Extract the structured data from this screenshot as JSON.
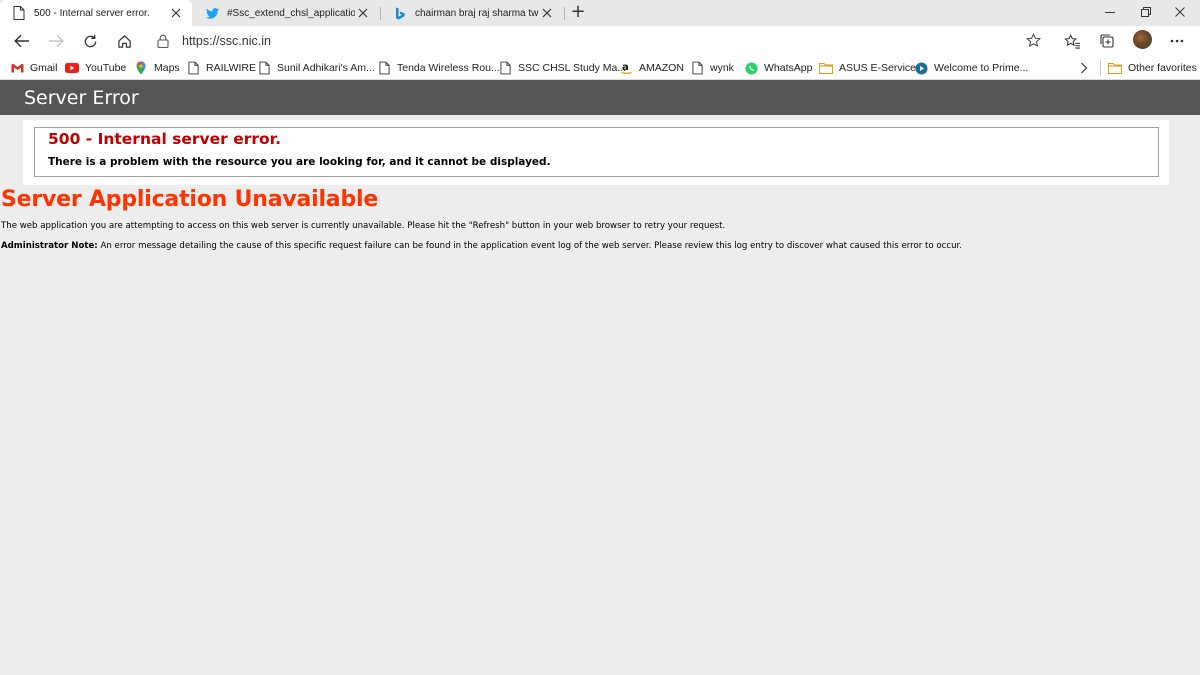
{
  "browser": {
    "tabs": [
      {
        "title": "500 - Internal server error.",
        "icon": "page-icon",
        "active": true
      },
      {
        "title": "#Ssc_extend_chsl_application_da",
        "icon": "twitter-icon",
        "active": false
      },
      {
        "title": "chairman braj raj sharma twitter",
        "icon": "bing-icon",
        "active": false
      }
    ],
    "new_tab_label": "+",
    "address": "https://ssc.nic.in",
    "favorites": [
      {
        "label": "Gmail",
        "icon": "gmail-icon"
      },
      {
        "label": "YouTube",
        "icon": "youtube-icon"
      },
      {
        "label": "Maps",
        "icon": "maps-pin-icon"
      },
      {
        "label": "RAILWIRE",
        "icon": "page-icon"
      },
      {
        "label": "Sunil Adhikari's Am...",
        "icon": "page-icon"
      },
      {
        "label": "Tenda Wireless Rou...",
        "icon": "page-icon"
      },
      {
        "label": "SSC CHSL Study Ma...",
        "icon": "page-icon"
      },
      {
        "label": "AMAZON",
        "icon": "amazon-icon"
      },
      {
        "label": "wynk",
        "icon": "page-icon"
      },
      {
        "label": "WhatsApp",
        "icon": "whatsapp-icon"
      },
      {
        "label": "ASUS E-Service",
        "icon": "folder-icon"
      },
      {
        "label": "Welcome to Prime...",
        "icon": "play-circle-icon"
      }
    ],
    "other_favorites": "Other favorites"
  },
  "page": {
    "header_title": "Server Error",
    "error_title": "500 - Internal server error.",
    "error_description": "There is a problem with the resource you are looking for, and it cannot be displayed.",
    "app_unavailable_title": "Server Application Unavailable",
    "paragraph1": "The web application you are attempting to access on this web server is currently unavailable.  Please hit the \"Refresh\" button in your web browser to retry your request.",
    "admin_note_label": "Administrator Note:",
    "admin_note_text": " An error message detailing the cause of this specific request failure can be found in the application event log of the web server. Please review this log entry to discover what caused this error to occur."
  },
  "colors": {
    "header_bar": "#555555",
    "error_red": "#c00000",
    "unavailable_orange": "#ff3300",
    "page_bg": "#ededed"
  }
}
